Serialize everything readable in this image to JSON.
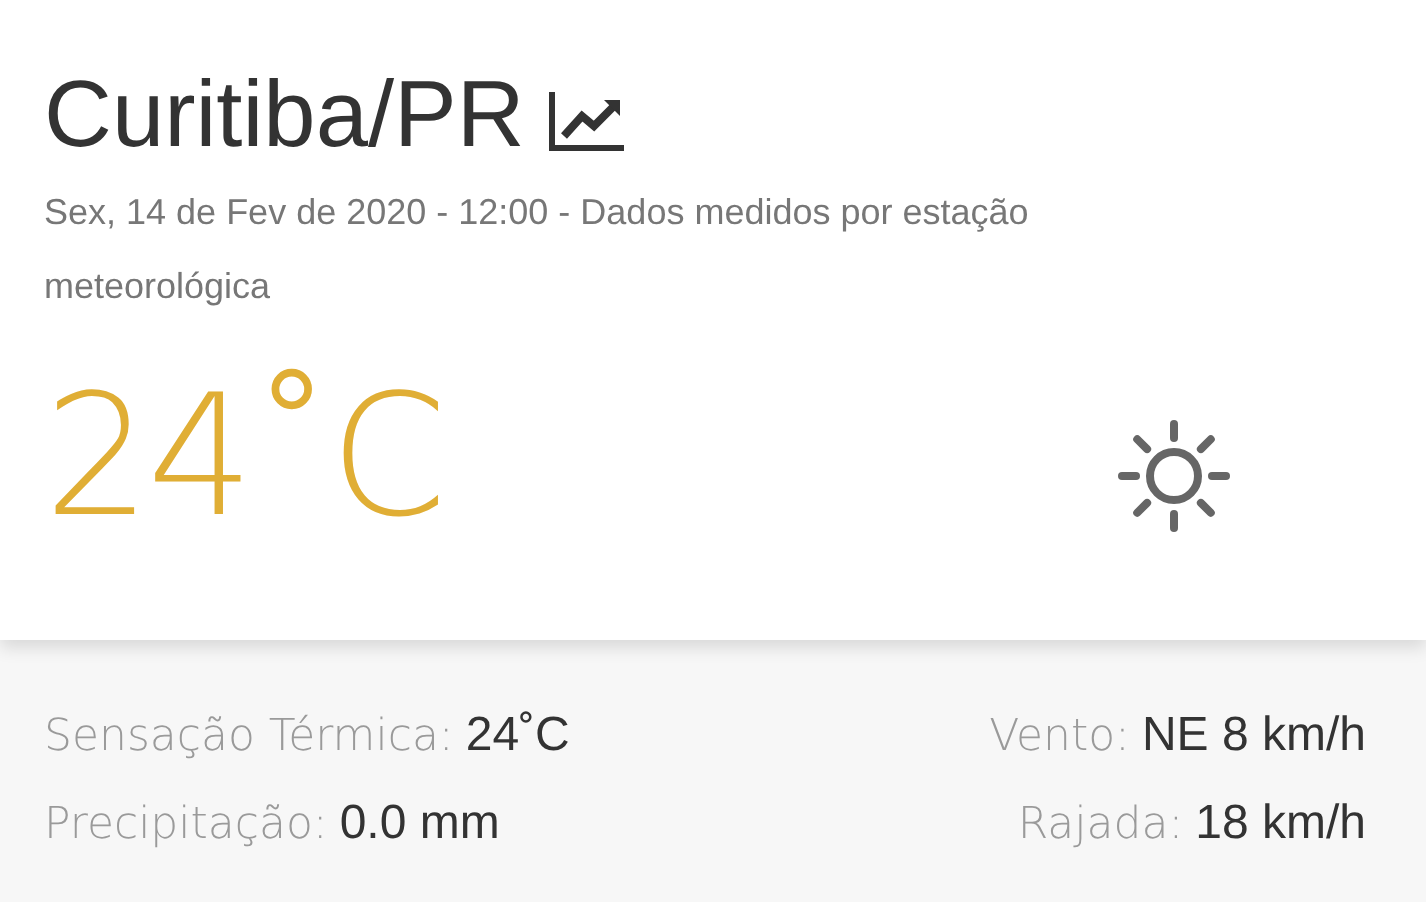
{
  "city": "Curitiba/PR",
  "subtitle": "Sex, 14 de Fev de 2020 - 12:00 - Dados medidos por estação meteorológica",
  "temperature": "24˚C",
  "details_left": [
    {
      "label": "Sensação Térmica:",
      "value": "24˚C"
    },
    {
      "label": "Precipitação:",
      "value": "0.0 mm"
    }
  ],
  "details_right": [
    {
      "label": "Vento:",
      "value": "NE 8 km/h"
    },
    {
      "label": "Rajada:",
      "value": "18 km/h"
    }
  ]
}
